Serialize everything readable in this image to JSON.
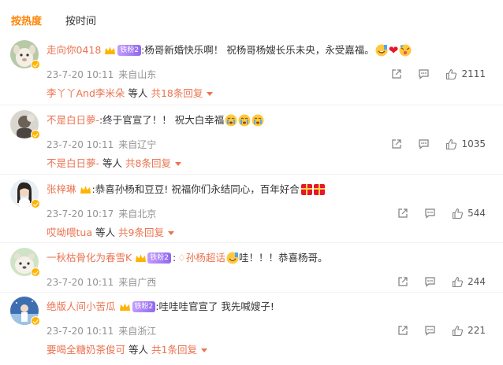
{
  "sort_tabs": {
    "hot": "按热度",
    "time": "按时间"
  },
  "colors": {
    "accent": "#ff8200",
    "username": "#eb7350",
    "meta": "#939393",
    "text": "#333333"
  },
  "comments": [
    {
      "username": "走向你0418",
      "fan_badge": "铁粉2",
      "text": ":杨哥新婚快乐啊！ 祝杨哥杨嫂长乐未央，永受嘉福。",
      "date": "23-7-20 10:11",
      "location": "来自山东",
      "likes": "2111",
      "reply_user": "李丫丫And李米朵",
      "reply_etc": "等人",
      "reply_count": "共18条回复"
    },
    {
      "username": "不是白日夢-",
      "text": ":终于官宣了！！ 祝大白幸福",
      "date": "23-7-20 10:11",
      "location": "来自辽宁",
      "likes": "1035",
      "reply_user": "不是白日夢-",
      "reply_etc": "等人",
      "reply_count": "共8条回复"
    },
    {
      "username": "张梓琳",
      "text": ":恭喜孙杨和豆豆! 祝福你们永结同心，百年好合",
      "date": "23-7-20 10:17",
      "location": "来自北京",
      "likes": "544",
      "reply_user": "哎呦喂tua",
      "reply_etc": "等人",
      "reply_count": "共9条回复"
    },
    {
      "username": "一秋枯骨化为春雪K",
      "fan_badge": "铁粉2",
      "text_prefix": ":",
      "topic": "孙杨超话",
      "text": "哇！！！恭喜杨哥。",
      "date": "23-7-20 10:11",
      "location": "来自广西",
      "likes": "244"
    },
    {
      "username": "绝版人间小苦瓜",
      "fan_badge": "铁粉2",
      "text": ":哇哇哇官宣了 我先喊嫂子!",
      "date": "23-7-20 10:11",
      "location": "来自浙江",
      "likes": "221",
      "reply_user": "要喝全糖奶茶俊可",
      "reply_etc": "等人",
      "reply_count": "共1条回复"
    }
  ]
}
